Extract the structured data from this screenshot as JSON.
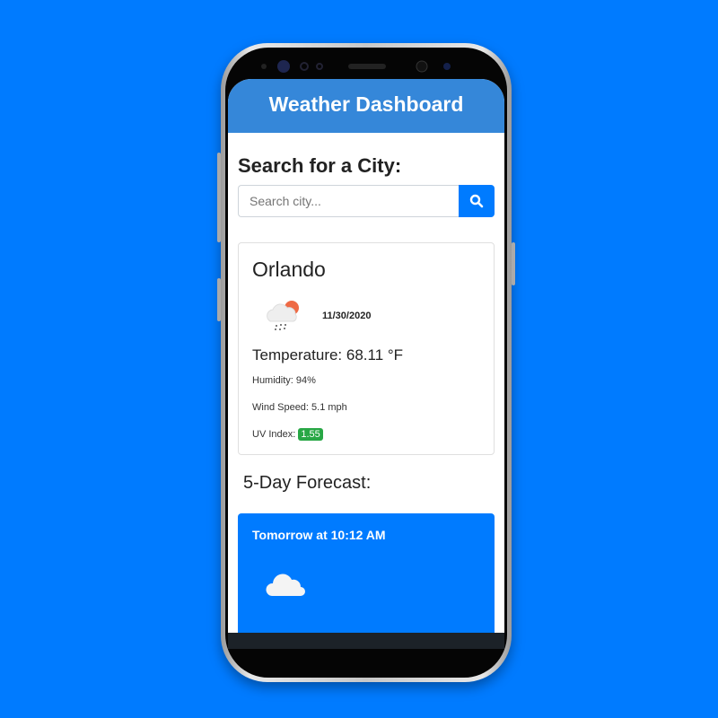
{
  "header": {
    "title": "Weather Dashboard"
  },
  "search": {
    "heading": "Search for a City:",
    "placeholder": "Search city...",
    "button_icon": "search-icon"
  },
  "current": {
    "city": "Orlando",
    "icon": "rain-cloud-sun-icon",
    "date": "11/30/2020",
    "temperature": "Temperature: 68.11 °F",
    "humidity": "Humidity: 94%",
    "wind": "Wind Speed: 5.1 mph",
    "uv_label": "UV Index:",
    "uv_value": "1.55",
    "uv_color": "#28a745"
  },
  "forecast": {
    "heading": "5-Day Forecast:",
    "items": [
      {
        "time": "Tomorrow at 10:12 AM",
        "icon": "cloud-icon"
      }
    ]
  }
}
